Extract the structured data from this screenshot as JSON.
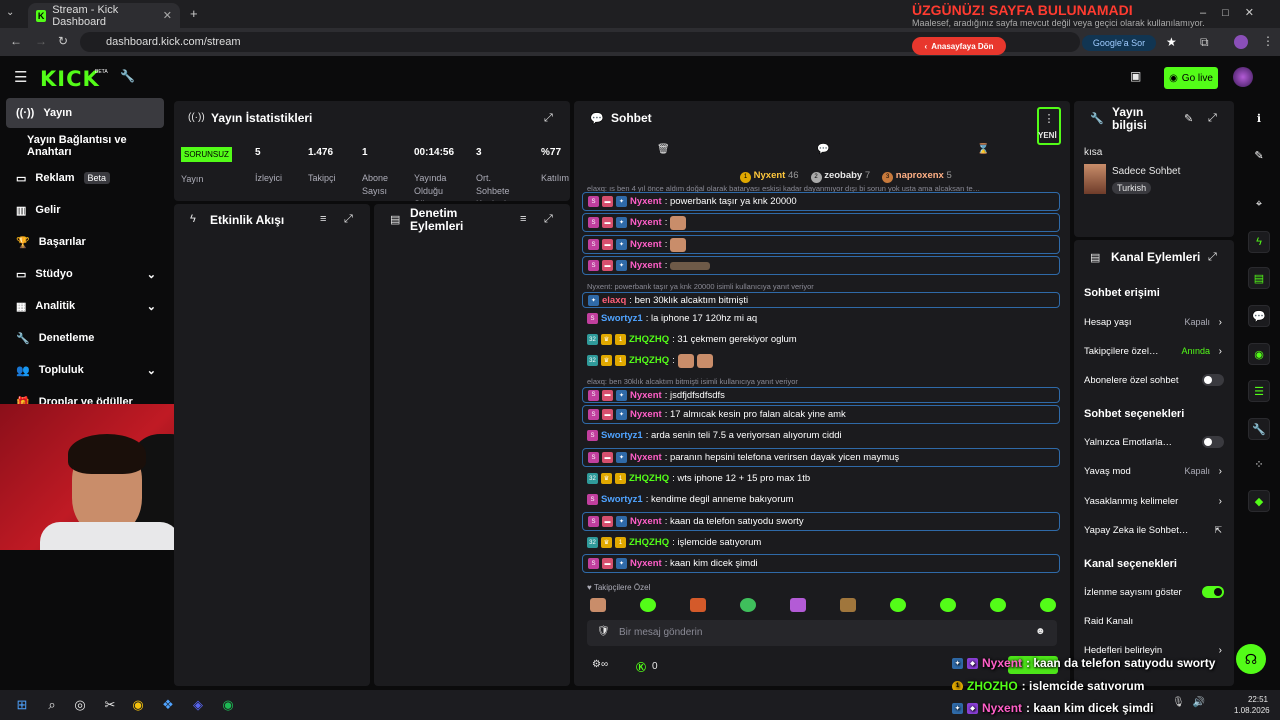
{
  "browser": {
    "tab_title": "Stream - Kick Dashboard",
    "url": "dashboard.kick.com/stream",
    "google_sor": "Google'a Sor",
    "overlay_title": "ÜZGÜNÜZ! SAYFA BULUNAMADI",
    "overlay_sub": "Maalesef, aradığınız sayfa mevcut değil veya geçici olarak kullanılamıyor.",
    "home_button": "Anasayfaya Dön"
  },
  "header": {
    "logo": "KICK",
    "beta": "BETA",
    "go_live": "Go live"
  },
  "sidebar": {
    "items": [
      {
        "label": "Yayın"
      },
      {
        "label": "Yayın Bağlantısı ve Anahtarı"
      },
      {
        "label": "Reklam",
        "badge": "Beta"
      },
      {
        "label": "Gelir"
      },
      {
        "label": "Başarılar"
      },
      {
        "label": "Stüdyo"
      },
      {
        "label": "Analitik"
      },
      {
        "label": "Denetleme"
      },
      {
        "label": "Topluluk"
      },
      {
        "label": "Droplar ve ödüller"
      }
    ]
  },
  "stats": {
    "title": "Yayın İstatistikleri",
    "status": "SORUNSUZ",
    "status_label": "Yayın",
    "items": [
      {
        "value": "5",
        "label": "İzleyici"
      },
      {
        "value": "1.476",
        "label": "Takipçi"
      },
      {
        "value": "1",
        "label": "Abone Sayısı"
      },
      {
        "value": "00:14:56",
        "label": "Yayında Olduğu Süre"
      },
      {
        "value": "3",
        "label": "Ort. Sohbete Katılanlar"
      },
      {
        "value": "%77",
        "label": "Katılım"
      }
    ]
  },
  "activity": {
    "title": "Etkinlik Akışı"
  },
  "moderation": {
    "title": "Denetim Eylemleri"
  },
  "chat": {
    "title": "Sohbet",
    "new_label": "YENİ",
    "leaders": [
      {
        "rank": "1",
        "name": "Nyxent",
        "count": "46"
      },
      {
        "rank": "2",
        "name": "zeobaby",
        "count": "7"
      },
      {
        "rank": "3",
        "name": "naproxenx",
        "count": "5"
      }
    ],
    "top_reply": "elaxq: ıs ben 4 yıl önce aldım doğal olarak bataryası eskisi kadar dayanmıyor dışı bi sorun yok usta ama alcaksan te…",
    "messages": [
      {
        "user": "Nyxent",
        "text": ": powerbank taşır ya knk 20000"
      },
      {
        "user": "Nyxent",
        "text": ":"
      },
      {
        "user": "Nyxent",
        "text": ":"
      },
      {
        "user": "Nyxent",
        "text": ":"
      },
      {
        "reply": "Nyxent: powerbank taşır ya knk 20000 isimli kullanıcıya yanıt veriyor",
        "user": "elaxq",
        "text": ": ben 30klık alcaktım bitmişti"
      },
      {
        "user": "Swortyz1",
        "text": ": la iphone 17 120hz mi aq"
      },
      {
        "user": "ZHQZHQ",
        "text": ": 31 çekmem gerekiyor oglum"
      },
      {
        "user": "ZHQZHQ",
        "text": ":"
      },
      {
        "reply": "elaxq: ben 30klık alcaktım bitmişti isimli kullanıcıya yanıt veriyor",
        "user": "Nyxent",
        "text": ": jsdfjdfsdfsdfs"
      },
      {
        "user": "Nyxent",
        "text": ": 17 almıcak kesin pro falan alcak yine amk"
      },
      {
        "user": "Swortyz1",
        "text": ": arda senin teli 7.5 a veriyorsan alıyorum ciddi"
      },
      {
        "user": "Nyxent",
        "text": ": paranın hepsini telefona verirsen dayak yicen maymuş"
      },
      {
        "user": "ZHQZHQ",
        "text": ": wts iphone 12 + 15 pro max 1tb"
      },
      {
        "user": "Swortyz1",
        "text": ": kendime degil anneme bakıyorum"
      },
      {
        "user": "Nyxent",
        "text": ": kaan da telefon satıyodu sworty"
      },
      {
        "user": "ZHQZHQ",
        "text": ": işlemcide satıyorum"
      },
      {
        "user": "Nyxent",
        "text": ": kaan kim dicek şimdi"
      }
    ],
    "followers_only": "Takipçilere Özel",
    "input_placeholder": "Bir mesaj gönderin",
    "kicks_count": "0"
  },
  "stream_info": {
    "title": "Yayın bilgisi",
    "stream_title": "kısa",
    "category": "Sadece Sohbet",
    "tag": "Turkish"
  },
  "channel_actions": {
    "title": "Kanal Eylemleri",
    "chat_access": "Sohbet erişimi",
    "account_age": {
      "label": "Hesap yaşı",
      "value": "Kapalı"
    },
    "followers_only": {
      "label": "Takipçilere özel…",
      "value": "Anında"
    },
    "subs_only": {
      "label": "Abonelere özel sohbet"
    },
    "chat_options": "Sohbet seçenekleri",
    "emotes_only": {
      "label": "Yalnızca Emotlarla…"
    },
    "slow_mode": {
      "label": "Yavaş mod",
      "value": "Kapalı"
    },
    "banned_words": {
      "label": "Yasaklanmış kelimeler"
    },
    "ai_chat": {
      "label": "Yapay Zeka ile Sohbet…"
    },
    "channel_options": "Kanal seçenekleri",
    "show_views": {
      "label": "İzlenme sayısını göster"
    },
    "raid": {
      "label": "Raid Kanalı"
    },
    "goals": {
      "label": "Hedefleri belirleyin"
    }
  },
  "overlay_chat": [
    {
      "user": "Nyxent",
      "text": ": kaan da telefon satıyodu sworty"
    },
    {
      "user": "ZHQZHQ",
      "text": ": işlemcide satıyorum"
    },
    {
      "user": "Nyxent",
      "text": ": kaan kim dicek şimdi"
    }
  ],
  "taskbar": {
    "time": "22:51",
    "date": "1.08.2026"
  },
  "colors": {
    "accent": "#53fc18",
    "pink_user": "#ff5fc8",
    "blue_user": "#4fa3ff",
    "green_user": "#53fc18",
    "red_user": "#ff5f7a"
  }
}
